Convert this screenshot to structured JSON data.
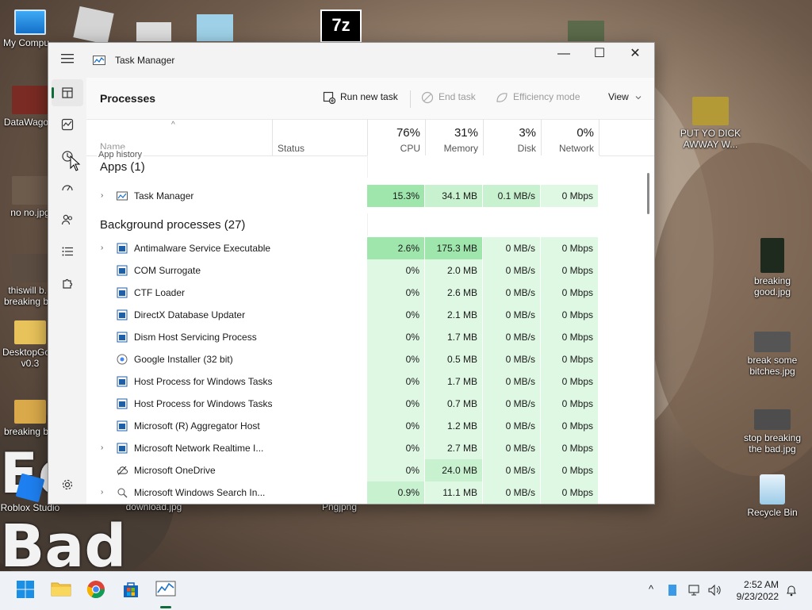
{
  "desktop": {
    "icons": [
      {
        "label": "My Compu..."
      },
      {
        "label": "DataWago..."
      },
      {
        "label": "no no.jpg"
      },
      {
        "label": "thiswill b... breaking b..."
      },
      {
        "label": "DesktopGo... v0.3"
      },
      {
        "label": "breaking b..."
      },
      {
        "label": "Roblox Studio"
      },
      {
        "label": "download.jpg"
      },
      {
        "label": "Pngjpng"
      },
      {
        "label": "PUT YO DICK AWWAY W..."
      },
      {
        "label": "breaking good.jpg"
      },
      {
        "label": "break some bitches.jpg"
      },
      {
        "label": "stop breaking the bad.jpg"
      },
      {
        "label": "Recycle Bin"
      }
    ],
    "wallpaper_text": [
      "Ed",
      "Bad"
    ]
  },
  "window": {
    "title": "Task Manager",
    "controls": {
      "minimize": "—",
      "maximize": "☐",
      "close": "✕"
    }
  },
  "sidebar": {
    "tooltip": "App history"
  },
  "toolbar": {
    "page_title": "Processes",
    "run_new_task": "Run new task",
    "end_task": "End task",
    "efficiency_mode": "Efficiency mode",
    "view": "View"
  },
  "columns": {
    "sort_indicator": "^",
    "name": "Name",
    "status": "Status",
    "cpu": {
      "pct": "76%",
      "label": "CPU"
    },
    "memory": {
      "pct": "31%",
      "label": "Memory"
    },
    "disk": {
      "pct": "3%",
      "label": "Disk"
    },
    "network": {
      "pct": "0%",
      "label": "Network"
    }
  },
  "groups": {
    "apps": "Apps (1)",
    "background": "Background processes (27)"
  },
  "apps": [
    {
      "name": "Task Manager",
      "cpu": "15.3%",
      "memory": "34.1 MB",
      "disk": "0.1 MB/s",
      "network": "0 Mbps"
    }
  ],
  "background": [
    {
      "name": "Antimalware Service Executable",
      "cpu": "2.6%",
      "memory": "175.3 MB",
      "disk": "0 MB/s",
      "network": "0 Mbps"
    },
    {
      "name": "COM Surrogate",
      "cpu": "0%",
      "memory": "2.0 MB",
      "disk": "0 MB/s",
      "network": "0 Mbps"
    },
    {
      "name": "CTF Loader",
      "cpu": "0%",
      "memory": "2.6 MB",
      "disk": "0 MB/s",
      "network": "0 Mbps"
    },
    {
      "name": "DirectX Database Updater",
      "cpu": "0%",
      "memory": "2.1 MB",
      "disk": "0 MB/s",
      "network": "0 Mbps"
    },
    {
      "name": "Dism Host Servicing Process",
      "cpu": "0%",
      "memory": "1.7 MB",
      "disk": "0 MB/s",
      "network": "0 Mbps"
    },
    {
      "name": "Google Installer (32 bit)",
      "cpu": "0%",
      "memory": "0.5 MB",
      "disk": "0 MB/s",
      "network": "0 Mbps"
    },
    {
      "name": "Host Process for Windows Tasks",
      "cpu": "0%",
      "memory": "1.7 MB",
      "disk": "0 MB/s",
      "network": "0 Mbps"
    },
    {
      "name": "Host Process for Windows Tasks",
      "cpu": "0%",
      "memory": "0.7 MB",
      "disk": "0 MB/s",
      "network": "0 Mbps"
    },
    {
      "name": "Microsoft (R) Aggregator Host",
      "cpu": "0%",
      "memory": "1.2 MB",
      "disk": "0 MB/s",
      "network": "0 Mbps"
    },
    {
      "name": "Microsoft Network Realtime I...",
      "cpu": "0%",
      "memory": "2.7 MB",
      "disk": "0 MB/s",
      "network": "0 Mbps"
    },
    {
      "name": "Microsoft OneDrive",
      "cpu": "0%",
      "memory": "24.0 MB",
      "disk": "0 MB/s",
      "network": "0 Mbps"
    },
    {
      "name": "Microsoft Windows Search In...",
      "cpu": "0.9%",
      "memory": "11.1 MB",
      "disk": "0 MB/s",
      "network": "0 Mbps"
    }
  ],
  "taskbar": {
    "tray_chevron": "^",
    "time": "2:52 AM",
    "date": "9/23/2022"
  },
  "colors": {
    "accent": "#0f6b3a",
    "heat_high": "#9fe6ad",
    "heat_mid": "#c8f1cf",
    "heat_low": "#def8e3"
  }
}
